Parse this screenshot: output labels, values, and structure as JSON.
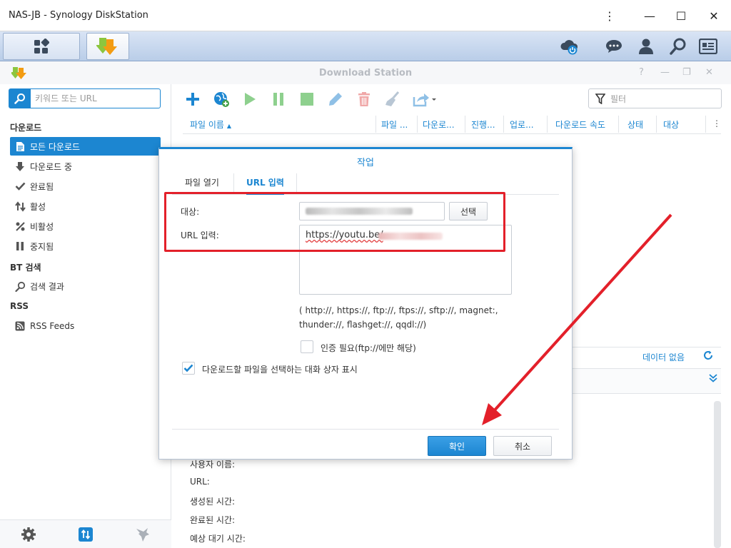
{
  "window": {
    "title": "NAS-JB - Synology DiskStation"
  },
  "app": {
    "title": "Download Station"
  },
  "sidebar": {
    "search_placeholder": "키워드 또는 URL",
    "sections": {
      "download": "다운로드",
      "bt_search": "BT 검색",
      "rss": "RSS"
    },
    "items": [
      {
        "label": "모든 다운로드",
        "icon": "document-icon",
        "active": true
      },
      {
        "label": "다운로드 중",
        "icon": "arrow-down-icon"
      },
      {
        "label": "완료됨",
        "icon": "checkmark-icon"
      },
      {
        "label": "활성",
        "icon": "arrows-up-down-icon"
      },
      {
        "label": "비활성",
        "icon": "percent-icon"
      },
      {
        "label": "중지됨",
        "icon": "pause-icon"
      },
      {
        "label": "검색 결과",
        "icon": "search-icon"
      },
      {
        "label": "RSS Feeds",
        "icon": "rss-icon"
      }
    ]
  },
  "toolbar": {
    "filter_placeholder": "필터",
    "icons": [
      "add-icon",
      "globe-add-icon",
      "play-icon",
      "pause-icon",
      "stop-icon",
      "edit-icon",
      "delete-icon",
      "clear-icon",
      "share-icon"
    ]
  },
  "table": {
    "columns": [
      "파일 이름",
      "파일 ...",
      "다운로...",
      "진행...",
      "업로...",
      "다운로드 속도",
      "상태",
      "대상"
    ],
    "no_data": "데이터 없음"
  },
  "details": {
    "labels": [
      "사용자 이름:",
      "URL:",
      "생성된 시간:",
      "완료된 시간:",
      "예상 대기 시간:"
    ]
  },
  "dialog": {
    "title": "작업",
    "tabs": [
      "파일 열기",
      "URL 입력"
    ],
    "active_tab": "URL 입력",
    "dest_label": "대상:",
    "select_button": "선택",
    "url_label": "URL 입력:",
    "url_value": "https://youtu.be/",
    "protocols_line1": "( http://, https://, ftp://, ftps://, sftp://, magnet:,",
    "protocols_line2": "thunder://, flashget://, qqdl://)",
    "auth_checkbox": "인증 필요(ftp://에만 해당)",
    "auth_checked": false,
    "dialog_checkbox": "다운로드할 파일을 선택하는 대화 상자 표시",
    "dialog_checked": true,
    "ok_button": "확인",
    "cancel_button": "취소"
  },
  "colors": {
    "accent": "#1c86d1",
    "annotation": "#e3202a"
  }
}
